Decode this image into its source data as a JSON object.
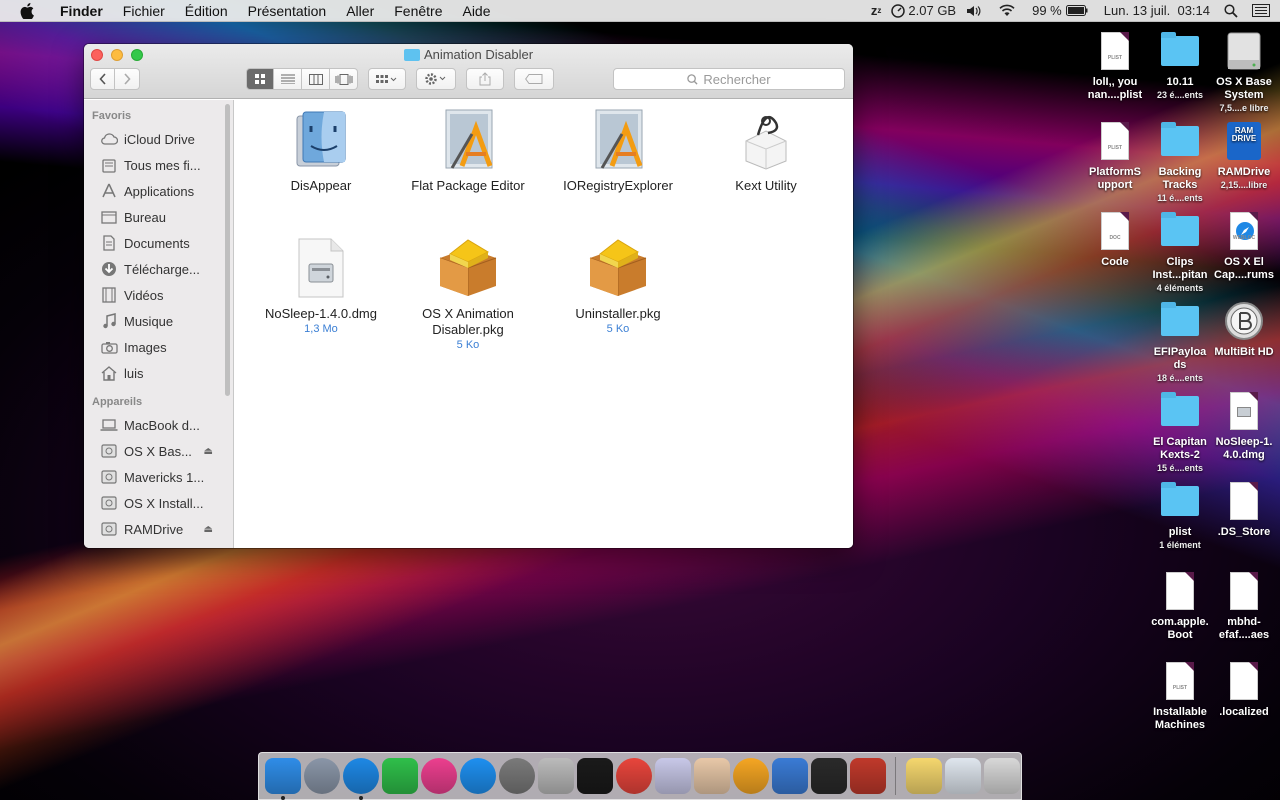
{
  "menubar": {
    "app_name": "Finder",
    "items": [
      "Fichier",
      "Édition",
      "Présentation",
      "Aller",
      "Fenêtre",
      "Aide"
    ],
    "memory": "2.07 GB",
    "battery": "99 %",
    "datetime": "Lun. 13 juil.  03:14"
  },
  "window": {
    "title": "Animation Disabler",
    "search_placeholder": "Rechercher"
  },
  "sidebar": {
    "favorites_heading": "Favoris",
    "favorites": [
      {
        "label": "iCloud Drive",
        "icon": "cloud-icon"
      },
      {
        "label": "Tous mes fi...",
        "icon": "all-files-icon"
      },
      {
        "label": "Applications",
        "icon": "applications-icon"
      },
      {
        "label": "Bureau",
        "icon": "desktop-icon"
      },
      {
        "label": "Documents",
        "icon": "documents-icon"
      },
      {
        "label": "Télécharge...",
        "icon": "downloads-icon"
      },
      {
        "label": "Vidéos",
        "icon": "movies-icon"
      },
      {
        "label": "Musique",
        "icon": "music-icon"
      },
      {
        "label": "Images",
        "icon": "camera-icon"
      },
      {
        "label": "luis",
        "icon": "home-icon"
      }
    ],
    "devices_heading": "Appareils",
    "devices": [
      {
        "label": "MacBook d...",
        "icon": "laptop-icon",
        "eject": false
      },
      {
        "label": "OS X Bas...",
        "icon": "disk-icon",
        "eject": true
      },
      {
        "label": "Mavericks 1...",
        "icon": "disk-icon",
        "eject": false
      },
      {
        "label": "OS X Install...",
        "icon": "disk-icon",
        "eject": false
      },
      {
        "label": "RAMDrive",
        "icon": "disk-icon",
        "eject": true
      }
    ]
  },
  "files": [
    {
      "name": "DisAppear",
      "meta": "",
      "icon": "finder-app-icon"
    },
    {
      "name": "Flat Package Editor",
      "meta": "",
      "icon": "xcode-tool-icon"
    },
    {
      "name": "IORegistryExplorer",
      "meta": "",
      "icon": "xcode-tool-icon"
    },
    {
      "name": "Kext Utility",
      "meta": "",
      "icon": "kext-utility-icon"
    },
    {
      "name": "NoSleep-1.4.0.dmg",
      "meta": "1,3 Mo",
      "icon": "dmg-icon"
    },
    {
      "name": "OS X Animation Disabler.pkg",
      "meta": "5 Ko",
      "icon": "package-icon"
    },
    {
      "name": "Uninstaller.pkg",
      "meta": "5 Ko",
      "icon": "package-icon"
    }
  ],
  "desktop": [
    {
      "name": "lolI,, you nan....plist",
      "sub": "",
      "kind": "plist"
    },
    {
      "name": "10.11",
      "sub": "23 é....ents",
      "kind": "folder"
    },
    {
      "name": "OS X Base System",
      "sub": "7,5....e libre",
      "kind": "drive"
    },
    {
      "name": "PlatformS upport",
      "sub": "",
      "kind": "plist"
    },
    {
      "name": "Backing Tracks",
      "sub": "11 é....ents",
      "kind": "folder"
    },
    {
      "name": "RAMDrive",
      "sub": "2,15....libre",
      "kind": "ramdrive"
    },
    {
      "name": "Code",
      "sub": "",
      "kind": "doc"
    },
    {
      "name": "Clips Inst...pitan",
      "sub": "4 éléments",
      "kind": "folder"
    },
    {
      "name": "OS X El Cap....rums",
      "sub": "",
      "kind": "webloc"
    },
    {
      "name": "EFIPayloa ds",
      "sub": "18 é....ents",
      "kind": "folder"
    },
    {
      "name": "MultiBit HD",
      "sub": "",
      "kind": "multibit"
    },
    {
      "name": "El Capitan Kexts-2",
      "sub": "15 é....ents",
      "kind": "folder"
    },
    {
      "name": "NoSleep-1. 4.0.dmg",
      "sub": "",
      "kind": "dmg"
    },
    {
      "name": "plist",
      "sub": "1 élément",
      "kind": "folder"
    },
    {
      "name": ".DS_Store",
      "sub": "",
      "kind": "blank"
    },
    {
      "name": "com.apple. Boot",
      "sub": "",
      "kind": "blank"
    },
    {
      "name": "mbhd- efaf....aes",
      "sub": "",
      "kind": "blank"
    },
    {
      "name": "Installable Machines",
      "sub": "",
      "kind": "plist"
    },
    {
      "name": ".localized",
      "sub": "",
      "kind": "blank"
    }
  ],
  "doc_labels": {
    "plist": "PLIST",
    "doc": "DOC",
    "webloc": "WEBLOC",
    "ramdrive": "RAM DRIVE"
  },
  "dock": [
    {
      "name": "finder-dock",
      "color": "#2f8de8",
      "running": true
    },
    {
      "name": "launchpad-dock",
      "color": "#8a96a8",
      "running": false
    },
    {
      "name": "safari-dock",
      "color": "#1e88e5",
      "running": true
    },
    {
      "name": "facetime-dock",
      "color": "#2fbf4a",
      "running": false
    },
    {
      "name": "itunes-dock",
      "color": "#ec3f8f",
      "running": false
    },
    {
      "name": "app-store-dock",
      "color": "#1e90f0",
      "running": false
    },
    {
      "name": "system-preferences-dock",
      "color": "#7a7a7a",
      "running": false
    },
    {
      "name": "kext-utility-dock",
      "color": "#bbbbbb",
      "running": false
    },
    {
      "name": "terminal-dock",
      "color": "#1a1a1a",
      "running": false
    },
    {
      "name": "chrome-dock",
      "color": "#e8453c",
      "running": false
    },
    {
      "name": "wizard-dock",
      "color": "#c8c8e8",
      "running": false
    },
    {
      "name": "characters-dock",
      "color": "#e8c8a8",
      "running": false
    },
    {
      "name": "photos-dock",
      "color": "#f5a623",
      "running": false
    },
    {
      "name": "xcode-dock",
      "color": "#3a7bd5",
      "running": false
    },
    {
      "name": "activity-monitor-dock",
      "color": "#2a2a2a",
      "running": false
    },
    {
      "name": "disk-utility-dock",
      "color": "#c0392b",
      "running": false
    },
    {
      "name": "stickies-dock",
      "color": "#f5d76e",
      "running": false
    },
    {
      "name": "preview-dock",
      "color": "#dfe6ee",
      "running": false
    },
    {
      "name": "trash-dock",
      "color": "#d8d8d8",
      "running": false
    }
  ]
}
